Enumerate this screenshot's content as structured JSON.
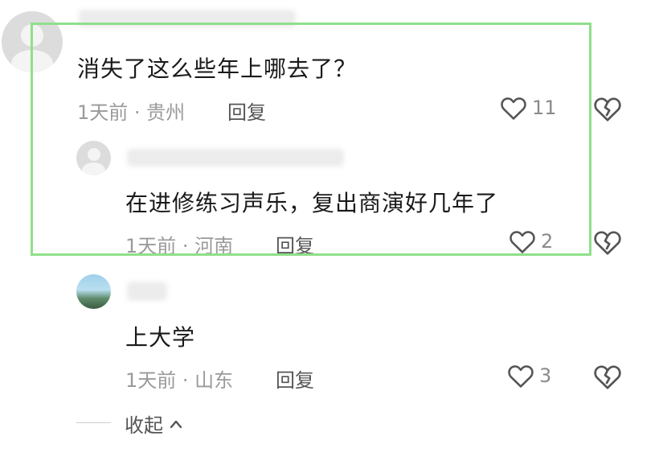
{
  "comments": [
    {
      "text": "消失了这么些年上哪去了？",
      "meta": "1天前 · 贵州",
      "reply_label": "回复",
      "likes": "11"
    },
    {
      "text": "在进修练习声乐，复出商演好几年了",
      "meta": "1天前 · 河南",
      "reply_label": "回复",
      "likes": "2"
    },
    {
      "text": "上大学",
      "meta": "1天前 · 山东",
      "reply_label": "回复",
      "likes": "3"
    }
  ],
  "collapse_label": "收起",
  "icons": {
    "like": "heart-outline-icon",
    "dislike": "broken-heart-icon",
    "collapse": "chevron-up-icon"
  },
  "colors": {
    "highlight_border": "#8fe08a",
    "meta_text": "#9a9a9a",
    "body_text": "#1a1a1a"
  }
}
